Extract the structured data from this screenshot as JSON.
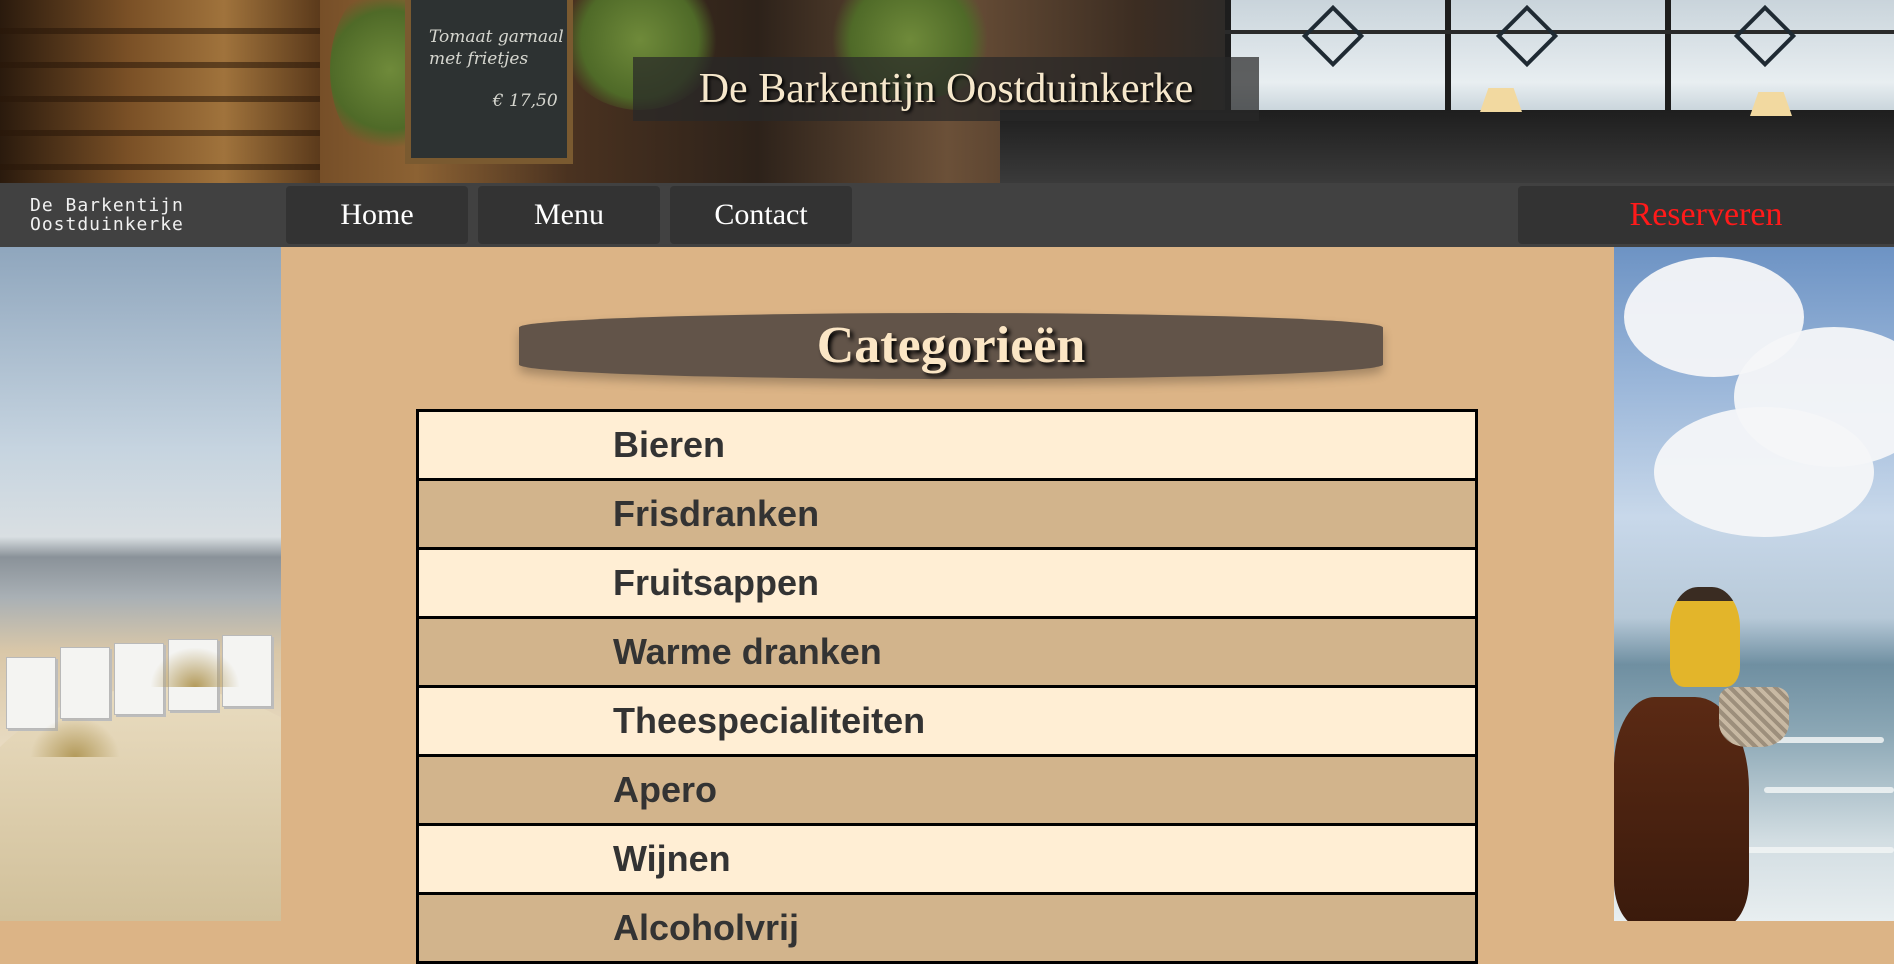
{
  "hero": {
    "title": "De Barkentijn Oostduinkerke",
    "chalkboard_lines": [
      "Tomaat garnaal",
      "met frietjes",
      "€ 17,50"
    ]
  },
  "nav": {
    "brand_line1": "De Barkentijn",
    "brand_line2": "Oostduinkerke",
    "links": [
      {
        "label": "Home"
      },
      {
        "label": "Menu"
      },
      {
        "label": "Contact"
      }
    ],
    "reserve_label": "Reserveren",
    "reserve_color": "#ff1a1a"
  },
  "main": {
    "header": "Categorieën",
    "categories": [
      {
        "label": "Bieren"
      },
      {
        "label": "Frisdranken"
      },
      {
        "label": "Fruitsappen"
      },
      {
        "label": "Warme dranken"
      },
      {
        "label": "Theespecialiteiten"
      },
      {
        "label": "Apero"
      },
      {
        "label": "Wijnen"
      },
      {
        "label": "Alcoholvrij"
      }
    ]
  },
  "colors": {
    "page_bg": "#dcb486",
    "nav_bg": "#414141",
    "button_bg": "#333333",
    "header_bg": "#625449",
    "row_light": "#ffeed4",
    "row_dark": "#d2b48c"
  }
}
